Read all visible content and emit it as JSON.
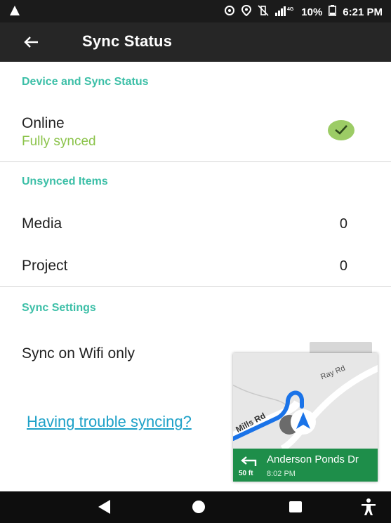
{
  "status_bar": {
    "network_type": "4G",
    "battery": "10%",
    "time": "6:21 PM"
  },
  "app_bar": {
    "title": "Sync Status",
    "back_icon": "arrow-left-icon"
  },
  "device_section": {
    "header": "Device and Sync Status",
    "status_label": "Online",
    "status_detail": "Fully synced",
    "status_icon": "check-circle-icon"
  },
  "unsynced_section": {
    "header": "Unsynced Items",
    "items": [
      {
        "label": "Media",
        "value": "0"
      },
      {
        "label": "Project",
        "value": "0"
      }
    ]
  },
  "settings_section": {
    "header": "Sync Settings",
    "wifi_only_label": "Sync on Wifi only"
  },
  "help": {
    "link_text": "Having trouble syncing?"
  },
  "navigation_overlay": {
    "street_labels": [
      "Ray Rd",
      "Mills Rd"
    ],
    "next_turn_street": "Anderson Ponds Dr",
    "distance": "50 ft",
    "eta": "8:02 PM",
    "turn_icon": "turn-left-icon"
  },
  "colors": {
    "accent": "#3cbfa7",
    "synced": "#8bc34a",
    "link": "#1ea1c8",
    "app_bar": "#262626",
    "nav_banner": "#1e8e4a"
  }
}
